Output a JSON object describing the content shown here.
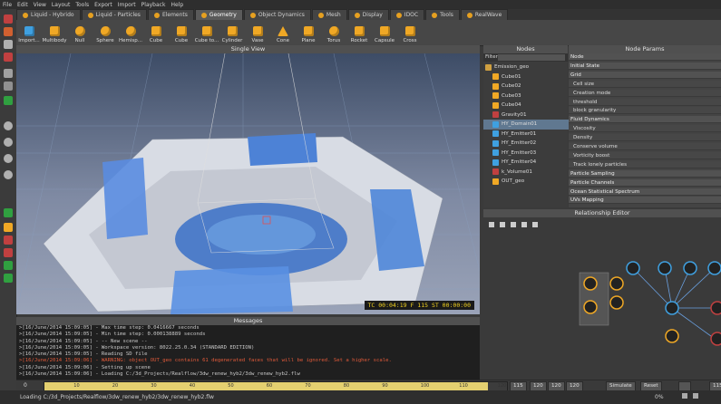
{
  "menu": [
    "File",
    "Edit",
    "View",
    "Layout",
    "Tools",
    "Export",
    "Import",
    "Playback",
    "Help"
  ],
  "tabs": [
    {
      "label": "Liquid - Hybrido",
      "active": false
    },
    {
      "label": "Liquid - Particles",
      "active": false
    },
    {
      "label": "Elements",
      "active": false
    },
    {
      "label": "Geometry",
      "active": true
    },
    {
      "label": "Object Dynamics",
      "active": false
    },
    {
      "label": "Mesh",
      "active": false
    },
    {
      "label": "Display",
      "active": false
    },
    {
      "label": "IDOC",
      "active": false
    },
    {
      "label": "Tools",
      "active": false
    },
    {
      "label": "RealWave",
      "active": false
    }
  ],
  "shelf": [
    "Import...",
    "Multibody",
    "Null",
    "Sphere",
    "Hemisp...",
    "Cube",
    "Cube",
    "Cube to...",
    "Cylinder",
    "Vase",
    "Cone",
    "Plane",
    "Torus",
    "Rocket",
    "Capsule",
    "Cross"
  ],
  "viewport": {
    "title": "Single View",
    "hud": "TC 00:04:19   F 115   ST 00:00:00"
  },
  "messages": {
    "title": "Messages",
    "lines": [
      {
        "text": ">[16/June/2014 15:09:05] - Max time step: 0.0416667 seconds",
        "warn": false
      },
      {
        "text": ">[16/June/2014 15:09:05] - Min time step: 0.000138889 seconds",
        "warn": false
      },
      {
        "text": ">[16/June/2014 15:09:05] - -- New scene --",
        "warn": false
      },
      {
        "text": ">[16/June/2014 15:09:05] - Workspace version: 8022.25.0.34 (STANDARD EDITION)",
        "warn": false
      },
      {
        "text": ">[16/June/2014 15:09:05] - Reading SD file",
        "warn": false
      },
      {
        "text": ">[16/June/2014 15:09:06] - WARNING: object OUT_geo contains 61 degenerated faces that will be ignored. Set a higher scale.",
        "warn": true
      },
      {
        "text": ">[16/June/2014 15:09:06] - Setting up scene",
        "warn": false
      },
      {
        "text": ">[16/June/2014 15:09:06] - Loading C:/3d_Projects/Realflow/3dw_renew_hyb2/3dw_renew_hyb2.flw",
        "warn": false
      }
    ]
  },
  "status": "Loading C:/3d_Projects/Realflow/3dw_renew_hyb2/3dw_renew_hyb2.flw",
  "timeline": {
    "start": "0",
    "current": "115",
    "end1": "120",
    "end2": "120",
    "end3": "120",
    "ticks": [
      "10",
      "20",
      "30",
      "40",
      "50",
      "60",
      "70",
      "80",
      "90",
      "100",
      "110",
      "120"
    ],
    "progress": 0.958
  },
  "controls": {
    "simulate": "Simulate",
    "reset": "Reset",
    "percent": "0%",
    "frame": "115"
  },
  "nodes": {
    "title": "Nodes",
    "filter": "Filter",
    "items": [
      {
        "label": "Emission_geo",
        "color": "#d0a040"
      },
      {
        "label": "Cube01",
        "color": "#f0a825"
      },
      {
        "label": "Cube02",
        "color": "#f0a825"
      },
      {
        "label": "Cube03",
        "color": "#f0a825"
      },
      {
        "label": "Cube04",
        "color": "#f0a825"
      },
      {
        "label": "Gravity01",
        "color": "#c04040"
      },
      {
        "label": "HY_Domain01",
        "color": "#3fa0e0"
      },
      {
        "label": "HY_Emitter01",
        "color": "#3fa0e0"
      },
      {
        "label": "HY_Emitter02",
        "color": "#3fa0e0"
      },
      {
        "label": "HY_Emitter03",
        "color": "#3fa0e0"
      },
      {
        "label": "HY_Emitter04",
        "color": "#3fa0e0"
      },
      {
        "label": "k_Volume01",
        "color": "#c04040"
      },
      {
        "label": "OUT_geo",
        "color": "#f0a825"
      }
    ]
  },
  "params": {
    "title": "Node Params",
    "rows": [
      {
        "text": "Node",
        "kind": "section"
      },
      {
        "text": "Initial State",
        "kind": "section"
      },
      {
        "text": "Grid",
        "kind": "section"
      },
      {
        "text": "Cell size",
        "kind": "sub"
      },
      {
        "text": "Creation mode",
        "kind": "sub"
      },
      {
        "text": "threshold",
        "kind": "sub"
      },
      {
        "text": "block granularity",
        "kind": "sub"
      },
      {
        "text": "Fluid Dynamics",
        "kind": "section"
      },
      {
        "text": "Viscosity",
        "kind": "sub"
      },
      {
        "text": "Density",
        "kind": "sub"
      },
      {
        "text": "Conserve volume",
        "kind": "sub"
      },
      {
        "text": "Vorticity boost",
        "kind": "sub"
      },
      {
        "text": "Track lonely particles",
        "kind": "sub"
      },
      {
        "text": "Particle Sampling",
        "kind": "section"
      },
      {
        "text": "Particle Channels",
        "kind": "section"
      },
      {
        "text": "Ocean Statistical Spectrum",
        "kind": "section"
      },
      {
        "text": "UVs Mapping",
        "kind": "section"
      }
    ]
  },
  "relationship": {
    "title": "Relationship Editor"
  }
}
